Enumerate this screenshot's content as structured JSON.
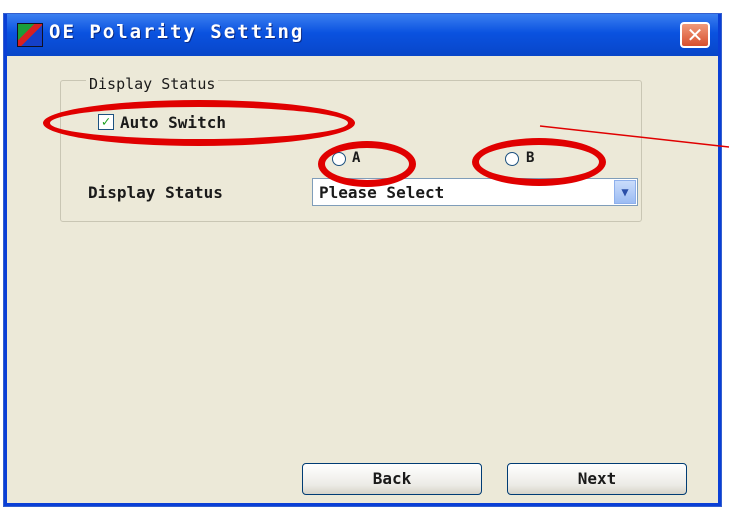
{
  "window": {
    "title": "OE Polarity Setting",
    "close_symbol": "✕",
    "title_icon": "app-icon"
  },
  "group": {
    "legend": "Display Status",
    "auto_switch_label": "Auto Switch",
    "auto_switch_checked": true,
    "radio_a_label": "A",
    "radio_b_label": "B",
    "display_status_label": "Display Status",
    "display_status_select": "Please Select"
  },
  "buttons": {
    "back": "Back",
    "next": "Next"
  },
  "colors": {
    "annotation": "#e00000",
    "titlebar": "#0a52e0",
    "dialog_bg": "#ece9d8"
  }
}
